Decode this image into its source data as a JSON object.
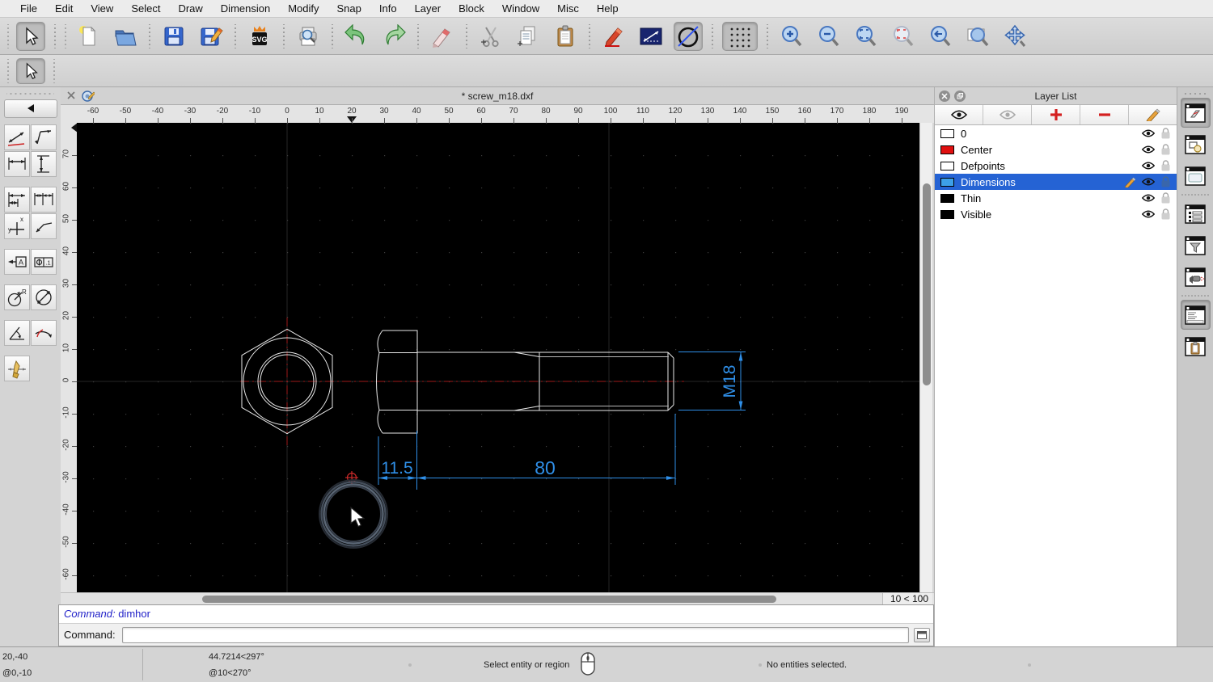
{
  "menubar": {
    "items": [
      "File",
      "Edit",
      "View",
      "Select",
      "Draw",
      "Dimension",
      "Modify",
      "Snap",
      "Info",
      "Layer",
      "Block",
      "Window",
      "Misc",
      "Help"
    ]
  },
  "document": {
    "tab_title": "* screw_m18.dxf"
  },
  "rulers": {
    "horizontal": [
      -60,
      -50,
      -40,
      -30,
      -20,
      -10,
      0,
      10,
      20,
      30,
      40,
      50,
      60,
      70,
      80,
      90,
      100,
      110,
      120,
      130,
      140,
      150,
      160,
      170,
      180,
      190
    ],
    "vertical": [
      70,
      60,
      50,
      40,
      30,
      20,
      10,
      0,
      -10,
      -20,
      -30,
      -40,
      -50,
      -60
    ]
  },
  "drawing_dimensions": {
    "head_width": "11.5",
    "shank_length": "80",
    "thread": "M18"
  },
  "icons_text": {
    "svg_badge": "SVG",
    "ordinate_x": "x",
    "ordinate_y": "y",
    "label_a": "A",
    "tolerance": ".1",
    "radius": "R"
  },
  "command": {
    "history_label": "Command:",
    "history_value": "dimhor",
    "prompt_label": "Command:",
    "input_value": ""
  },
  "status": {
    "abs_coord": "20,-40",
    "rel_coord": "@0,-10",
    "polar_coord": "44.7214<297°",
    "polar_rel": "@10<270°",
    "hint": "Select entity or region",
    "selection": "No entities selected.",
    "grid_range": "10 < 100"
  },
  "layer_panel": {
    "title": "Layer List",
    "layers": [
      {
        "name": "0",
        "color": "#ffffff",
        "selected": false
      },
      {
        "name": "Center",
        "color": "#e01010",
        "selected": false
      },
      {
        "name": "Defpoints",
        "color": "#ffffff",
        "selected": false
      },
      {
        "name": "Dimensions",
        "color": "#3da0e8",
        "selected": true
      },
      {
        "name": "Thin",
        "color": "#000000",
        "selected": false
      },
      {
        "name": "Visible",
        "color": "#000000",
        "selected": false
      }
    ]
  },
  "colors": {
    "dimension_blue": "#2f8fe8",
    "centerline_red": "#9e1a1a",
    "selection_blue": "#2563d4",
    "canvas_black": "#000000",
    "outline_white": "#e8e8e8"
  }
}
